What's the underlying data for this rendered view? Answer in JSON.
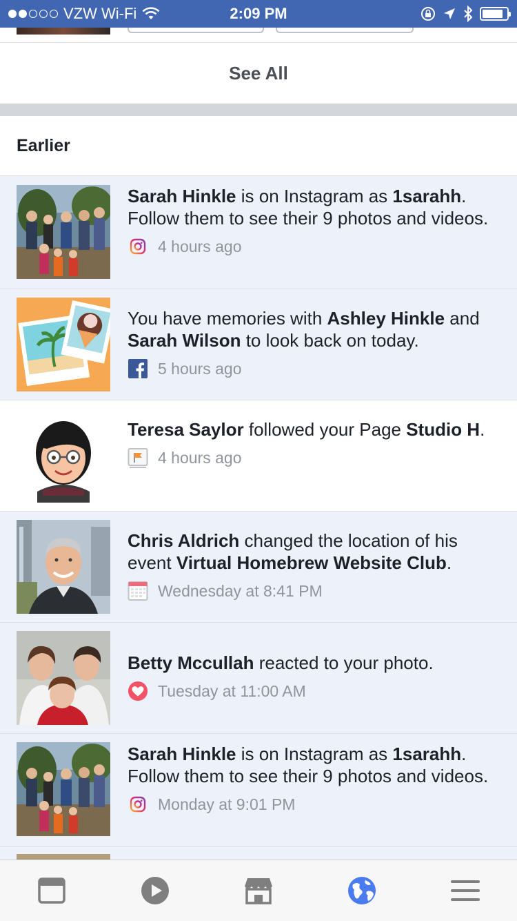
{
  "status_bar": {
    "carrier": "VZW Wi-Fi",
    "time": "2:09 PM",
    "signal_bars_filled": 2,
    "signal_bars_total": 5,
    "battery_level": 0.85
  },
  "see_all_label": "See All",
  "section_title": "Earlier",
  "notifications": [
    {
      "parts": [
        [
          "Sarah Hinkle",
          true
        ],
        [
          " is on Instagram as ",
          false
        ],
        [
          "1sarahh",
          true
        ],
        [
          ". Follow them to see their 9 photos and videos.",
          false
        ]
      ],
      "icon": "instagram-icon",
      "time": "4 hours ago",
      "unread": true
    },
    {
      "parts": [
        [
          "You have memories with ",
          false
        ],
        [
          "Ashley Hinkle",
          true
        ],
        [
          " and ",
          false
        ],
        [
          "Sarah Wilson",
          true
        ],
        [
          " to look back on today.",
          false
        ]
      ],
      "icon": "facebook-icon",
      "time": "5 hours ago",
      "unread": true
    },
    {
      "parts": [
        [
          "Teresa Saylor",
          true
        ],
        [
          " followed your Page ",
          false
        ],
        [
          "Studio H",
          true
        ],
        [
          ".",
          false
        ]
      ],
      "icon": "page-flag-icon",
      "time": "4 hours ago",
      "unread": false
    },
    {
      "parts": [
        [
          "Chris Aldrich",
          true
        ],
        [
          " changed the location of his event ",
          false
        ],
        [
          "Virtual Homebrew Website Club",
          true
        ],
        [
          ".",
          false
        ]
      ],
      "icon": "calendar-icon",
      "time": "Wednesday at 8:41 PM",
      "unread": true
    },
    {
      "parts": [
        [
          "Betty Mccullah",
          true
        ],
        [
          " reacted to your photo.",
          false
        ]
      ],
      "icon": "heart-reaction-icon",
      "time": "Tuesday at 11:00 AM",
      "unread": true
    },
    {
      "parts": [
        [
          "Sarah Hinkle",
          true
        ],
        [
          " is on Instagram as ",
          false
        ],
        [
          "1sarahh",
          true
        ],
        [
          ". Follow them to see their 9 photos and videos.",
          false
        ]
      ],
      "icon": "instagram-icon",
      "time": "Monday at 9:01 PM",
      "unread": true
    }
  ],
  "tab_bar": [
    "news-feed-icon",
    "video-icon",
    "marketplace-icon",
    "notifications-globe-icon",
    "menu-icon"
  ],
  "colors": {
    "brand_blue": "#4267b2",
    "unread_bg": "#edf2fa",
    "meta_gray": "#90949c",
    "active_tab": "#4a7cf0"
  }
}
